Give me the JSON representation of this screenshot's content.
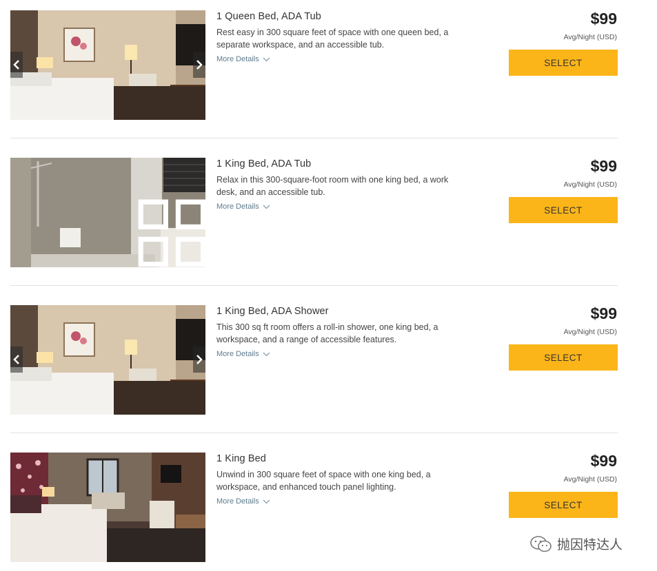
{
  "rooms": [
    {
      "title": "1 Queen Bed, ADA Tub",
      "description": "Rest easy in 300 square feet of space with one queen bed, a separate workspace, and an accessible tub.",
      "more_details": "More Details",
      "price": "$99",
      "price_note": "Avg/Night (USD)",
      "select": "SELECT"
    },
    {
      "title": "1 King Bed, ADA Tub",
      "description": "Relax in this 300-square-foot room with one king bed, a work desk, and an accessible tub.",
      "more_details": "More Details",
      "price": "$99",
      "price_note": "Avg/Night (USD)",
      "select": "SELECT"
    },
    {
      "title": "1 King Bed, ADA Shower",
      "description": "This 300 sq ft room offers a roll-in shower, one king bed, a workspace, and a range of accessible features.",
      "more_details": "More Details",
      "price": "$99",
      "price_note": "Avg/Night (USD)",
      "select": "SELECT"
    },
    {
      "title": "1 King Bed",
      "description": "Unwind in 300 square feet of space with one king bed, a workspace, and enhanced touch panel lighting.",
      "more_details": "More Details",
      "price": "$99",
      "price_note": "Avg/Night (USD)",
      "select": "SELECT"
    }
  ],
  "watermark": {
    "text": "抛因特达人",
    "icon": "wechat-icon"
  },
  "colors": {
    "select_button": "#fbb519",
    "link": "#5d7b8e",
    "divider": "#e2e2e2"
  }
}
